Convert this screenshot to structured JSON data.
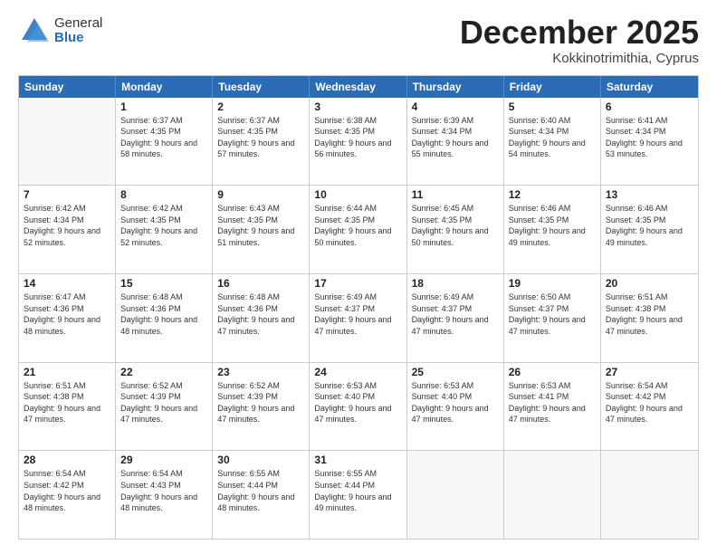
{
  "header": {
    "logo_general": "General",
    "logo_blue": "Blue",
    "month": "December 2025",
    "location": "Kokkinotrimithia, Cyprus"
  },
  "days": [
    "Sunday",
    "Monday",
    "Tuesday",
    "Wednesday",
    "Thursday",
    "Friday",
    "Saturday"
  ],
  "weeks": [
    [
      {
        "day": "",
        "sunrise": "",
        "sunset": "",
        "daylight": ""
      },
      {
        "day": "1",
        "sunrise": "Sunrise: 6:37 AM",
        "sunset": "Sunset: 4:35 PM",
        "daylight": "Daylight: 9 hours and 58 minutes."
      },
      {
        "day": "2",
        "sunrise": "Sunrise: 6:37 AM",
        "sunset": "Sunset: 4:35 PM",
        "daylight": "Daylight: 9 hours and 57 minutes."
      },
      {
        "day": "3",
        "sunrise": "Sunrise: 6:38 AM",
        "sunset": "Sunset: 4:35 PM",
        "daylight": "Daylight: 9 hours and 56 minutes."
      },
      {
        "day": "4",
        "sunrise": "Sunrise: 6:39 AM",
        "sunset": "Sunset: 4:34 PM",
        "daylight": "Daylight: 9 hours and 55 minutes."
      },
      {
        "day": "5",
        "sunrise": "Sunrise: 6:40 AM",
        "sunset": "Sunset: 4:34 PM",
        "daylight": "Daylight: 9 hours and 54 minutes."
      },
      {
        "day": "6",
        "sunrise": "Sunrise: 6:41 AM",
        "sunset": "Sunset: 4:34 PM",
        "daylight": "Daylight: 9 hours and 53 minutes."
      }
    ],
    [
      {
        "day": "7",
        "sunrise": "Sunrise: 6:42 AM",
        "sunset": "Sunset: 4:34 PM",
        "daylight": "Daylight: 9 hours and 52 minutes."
      },
      {
        "day": "8",
        "sunrise": "Sunrise: 6:42 AM",
        "sunset": "Sunset: 4:35 PM",
        "daylight": "Daylight: 9 hours and 52 minutes."
      },
      {
        "day": "9",
        "sunrise": "Sunrise: 6:43 AM",
        "sunset": "Sunset: 4:35 PM",
        "daylight": "Daylight: 9 hours and 51 minutes."
      },
      {
        "day": "10",
        "sunrise": "Sunrise: 6:44 AM",
        "sunset": "Sunset: 4:35 PM",
        "daylight": "Daylight: 9 hours and 50 minutes."
      },
      {
        "day": "11",
        "sunrise": "Sunrise: 6:45 AM",
        "sunset": "Sunset: 4:35 PM",
        "daylight": "Daylight: 9 hours and 50 minutes."
      },
      {
        "day": "12",
        "sunrise": "Sunrise: 6:46 AM",
        "sunset": "Sunset: 4:35 PM",
        "daylight": "Daylight: 9 hours and 49 minutes."
      },
      {
        "day": "13",
        "sunrise": "Sunrise: 6:46 AM",
        "sunset": "Sunset: 4:35 PM",
        "daylight": "Daylight: 9 hours and 49 minutes."
      }
    ],
    [
      {
        "day": "14",
        "sunrise": "Sunrise: 6:47 AM",
        "sunset": "Sunset: 4:36 PM",
        "daylight": "Daylight: 9 hours and 48 minutes."
      },
      {
        "day": "15",
        "sunrise": "Sunrise: 6:48 AM",
        "sunset": "Sunset: 4:36 PM",
        "daylight": "Daylight: 9 hours and 48 minutes."
      },
      {
        "day": "16",
        "sunrise": "Sunrise: 6:48 AM",
        "sunset": "Sunset: 4:36 PM",
        "daylight": "Daylight: 9 hours and 47 minutes."
      },
      {
        "day": "17",
        "sunrise": "Sunrise: 6:49 AM",
        "sunset": "Sunset: 4:37 PM",
        "daylight": "Daylight: 9 hours and 47 minutes."
      },
      {
        "day": "18",
        "sunrise": "Sunrise: 6:49 AM",
        "sunset": "Sunset: 4:37 PM",
        "daylight": "Daylight: 9 hours and 47 minutes."
      },
      {
        "day": "19",
        "sunrise": "Sunrise: 6:50 AM",
        "sunset": "Sunset: 4:37 PM",
        "daylight": "Daylight: 9 hours and 47 minutes."
      },
      {
        "day": "20",
        "sunrise": "Sunrise: 6:51 AM",
        "sunset": "Sunset: 4:38 PM",
        "daylight": "Daylight: 9 hours and 47 minutes."
      }
    ],
    [
      {
        "day": "21",
        "sunrise": "Sunrise: 6:51 AM",
        "sunset": "Sunset: 4:38 PM",
        "daylight": "Daylight: 9 hours and 47 minutes."
      },
      {
        "day": "22",
        "sunrise": "Sunrise: 6:52 AM",
        "sunset": "Sunset: 4:39 PM",
        "daylight": "Daylight: 9 hours and 47 minutes."
      },
      {
        "day": "23",
        "sunrise": "Sunrise: 6:52 AM",
        "sunset": "Sunset: 4:39 PM",
        "daylight": "Daylight: 9 hours and 47 minutes."
      },
      {
        "day": "24",
        "sunrise": "Sunrise: 6:53 AM",
        "sunset": "Sunset: 4:40 PM",
        "daylight": "Daylight: 9 hours and 47 minutes."
      },
      {
        "day": "25",
        "sunrise": "Sunrise: 6:53 AM",
        "sunset": "Sunset: 4:40 PM",
        "daylight": "Daylight: 9 hours and 47 minutes."
      },
      {
        "day": "26",
        "sunrise": "Sunrise: 6:53 AM",
        "sunset": "Sunset: 4:41 PM",
        "daylight": "Daylight: 9 hours and 47 minutes."
      },
      {
        "day": "27",
        "sunrise": "Sunrise: 6:54 AM",
        "sunset": "Sunset: 4:42 PM",
        "daylight": "Daylight: 9 hours and 47 minutes."
      }
    ],
    [
      {
        "day": "28",
        "sunrise": "Sunrise: 6:54 AM",
        "sunset": "Sunset: 4:42 PM",
        "daylight": "Daylight: 9 hours and 48 minutes."
      },
      {
        "day": "29",
        "sunrise": "Sunrise: 6:54 AM",
        "sunset": "Sunset: 4:43 PM",
        "daylight": "Daylight: 9 hours and 48 minutes."
      },
      {
        "day": "30",
        "sunrise": "Sunrise: 6:55 AM",
        "sunset": "Sunset: 4:44 PM",
        "daylight": "Daylight: 9 hours and 48 minutes."
      },
      {
        "day": "31",
        "sunrise": "Sunrise: 6:55 AM",
        "sunset": "Sunset: 4:44 PM",
        "daylight": "Daylight: 9 hours and 49 minutes."
      },
      {
        "day": "",
        "sunrise": "",
        "sunset": "",
        "daylight": ""
      },
      {
        "day": "",
        "sunrise": "",
        "sunset": "",
        "daylight": ""
      },
      {
        "day": "",
        "sunrise": "",
        "sunset": "",
        "daylight": ""
      }
    ]
  ]
}
